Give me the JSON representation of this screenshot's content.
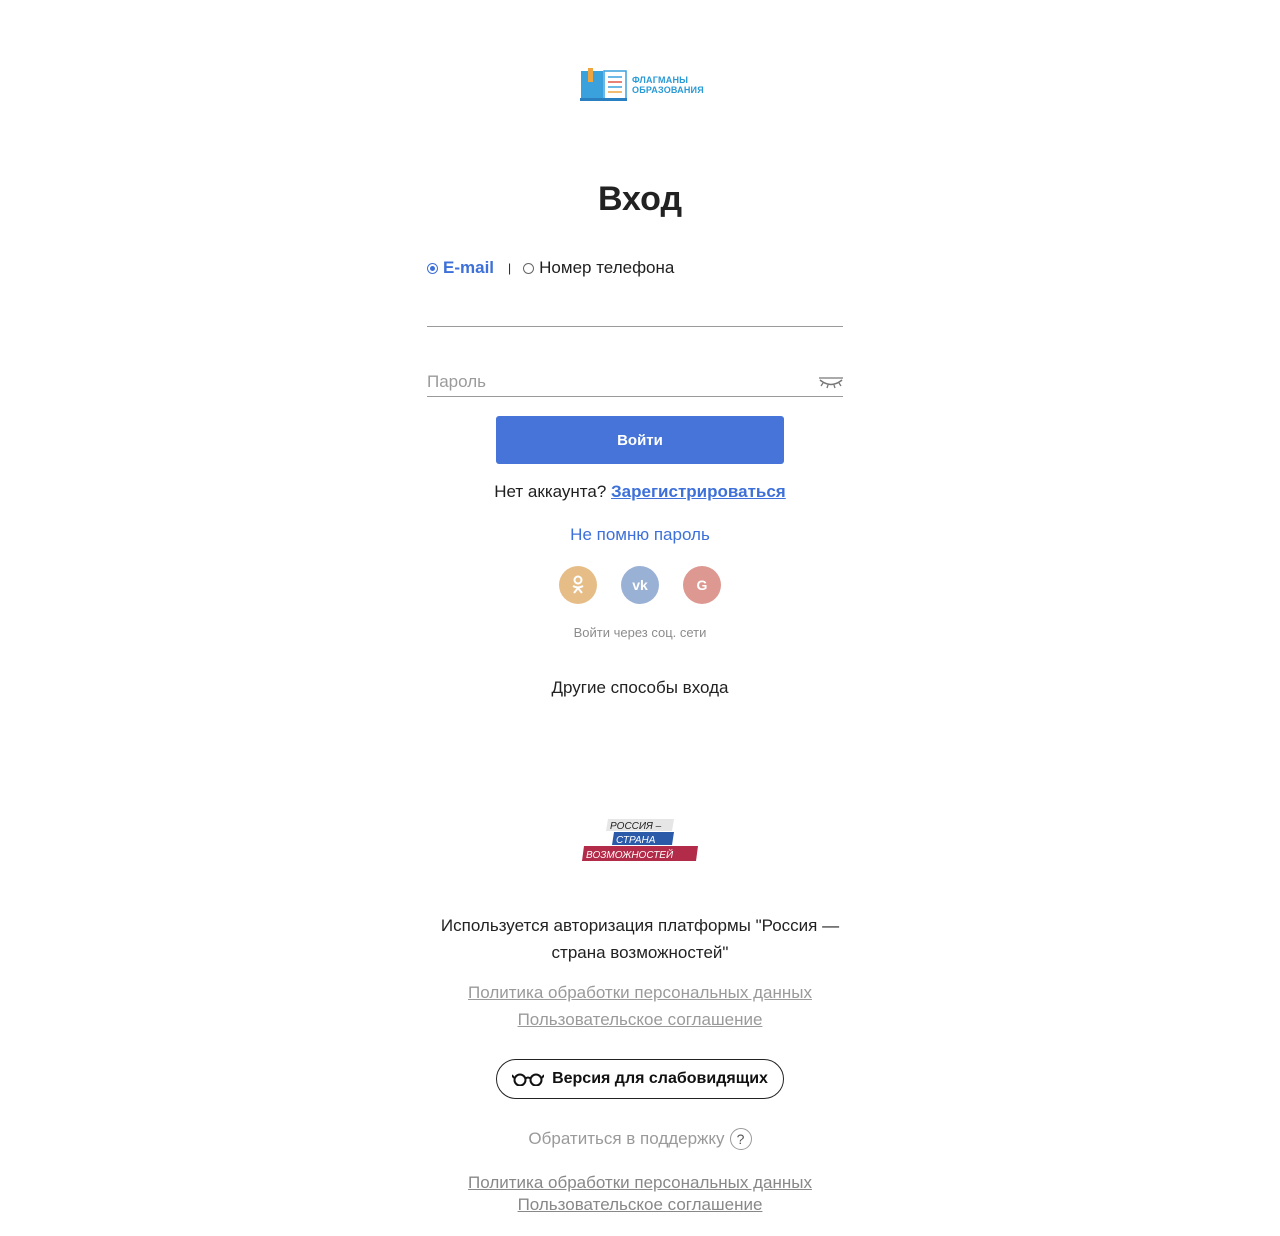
{
  "logo": {
    "line1": "ФЛАГМАНЫ",
    "line2": "ОБРАЗОВАНИЯ",
    "icon": "book-icon",
    "color": "#2a9ad6"
  },
  "title": "Вход",
  "login_mode": {
    "options": [
      {
        "label": "E-mail",
        "selected": true
      },
      {
        "label": "Номер телефона",
        "selected": false
      }
    ],
    "separator": "|"
  },
  "form": {
    "login_value": "",
    "password_placeholder": "Пароль",
    "submit_label": "Войти"
  },
  "register": {
    "prompt": "Нет аккаунта?",
    "link": "Зарегистрироваться"
  },
  "forgot_password": "Не помню пароль",
  "social": {
    "items": [
      {
        "icon": "odnoklassniki-icon",
        "glyph": "ок",
        "color": "#e6bd87"
      },
      {
        "icon": "vk-icon",
        "glyph": "vk",
        "color": "#9ab1d6"
      },
      {
        "icon": "google-icon",
        "glyph": "G",
        "color": "#dd9891"
      }
    ],
    "caption": "Войти через соц. сети"
  },
  "other_methods": "Другие способы входа",
  "rsv_logo": {
    "line1": "РОССИЯ –",
    "line2": "СТРАНА",
    "line3": "ВОЗМОЖНОСТЕЙ"
  },
  "auth_note": "Используется авторизация платформы \"Россия — страна возможностей\"",
  "links_top": {
    "privacy": "Политика обработки персональных данных",
    "agreement": "Пользовательское соглашение"
  },
  "accessibility_button": "Версия для слабовидящих",
  "support": {
    "label": "Обратиться в поддержку",
    "icon_glyph": "?"
  },
  "links_bottom": {
    "privacy": "Политика обработки персональных данных",
    "agreement": "Пользовательское соглашение"
  },
  "colors": {
    "accent": "#4674d9",
    "link": "#3d70d8",
    "muted": "#9a9a9a"
  }
}
